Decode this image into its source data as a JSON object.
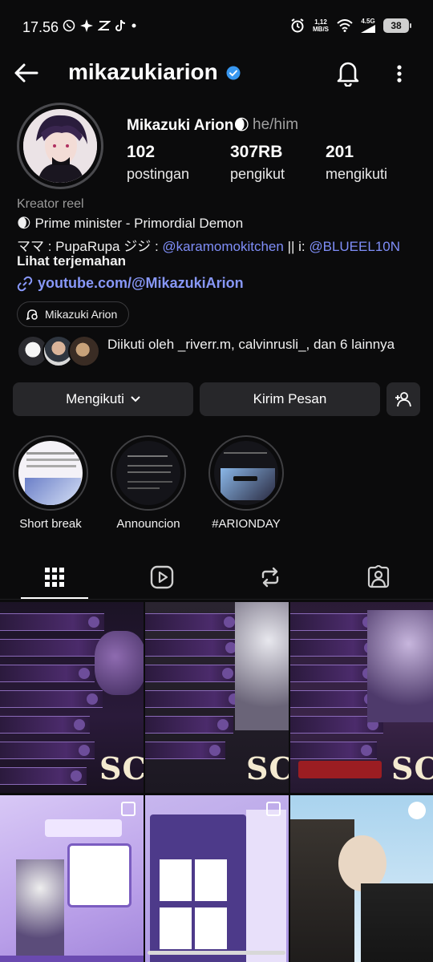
{
  "status_bar": {
    "time": "17.56",
    "net_speed_value": "1,12",
    "net_speed_unit": "MB/S",
    "network": "4.5G",
    "battery": "38"
  },
  "profile": {
    "username": "mikazukiarion",
    "display_name": "Mikazuki Arion🌒",
    "pronouns": "he/him",
    "stats": [
      {
        "value": "102",
        "label": "postingan"
      },
      {
        "value": "307RB",
        "label": "pengikut"
      },
      {
        "value": "201",
        "label": "mengikuti"
      }
    ],
    "category": "Kreator reel",
    "bio": {
      "line1": "🌒 Prime minister - Primordial Demon",
      "line2_prefix": "ママ : PupaRupa ジジ : ",
      "line2_mention1": "@karamomokitchen",
      "line2_mid": " || i: ",
      "line2_mention2": "@BLUEEL10N"
    },
    "translate_label": "Lihat terjemahan",
    "link": "youtube.com/@MikazukiArion",
    "channel_chip": "Mikazuki Arion",
    "followed_by": "Diikuti oleh _riverr.m, calvinrusli_, dan 6 lainnya"
  },
  "actions": {
    "following": "Mengikuti",
    "message": "Kirim Pesan"
  },
  "highlights": [
    {
      "label": "Short break"
    },
    {
      "label": "Announcion"
    },
    {
      "label": "#ARIONDAY"
    }
  ],
  "tabs": [
    "grid-icon",
    "reels-icon",
    "reposts-icon",
    "tagged-icon"
  ],
  "posts": {
    "sc_text": "SC"
  },
  "colors": {
    "background": "#0b0b0c",
    "accent_link": "#8898f9",
    "verified": "#3897f0",
    "button_bg": "#27272a"
  }
}
